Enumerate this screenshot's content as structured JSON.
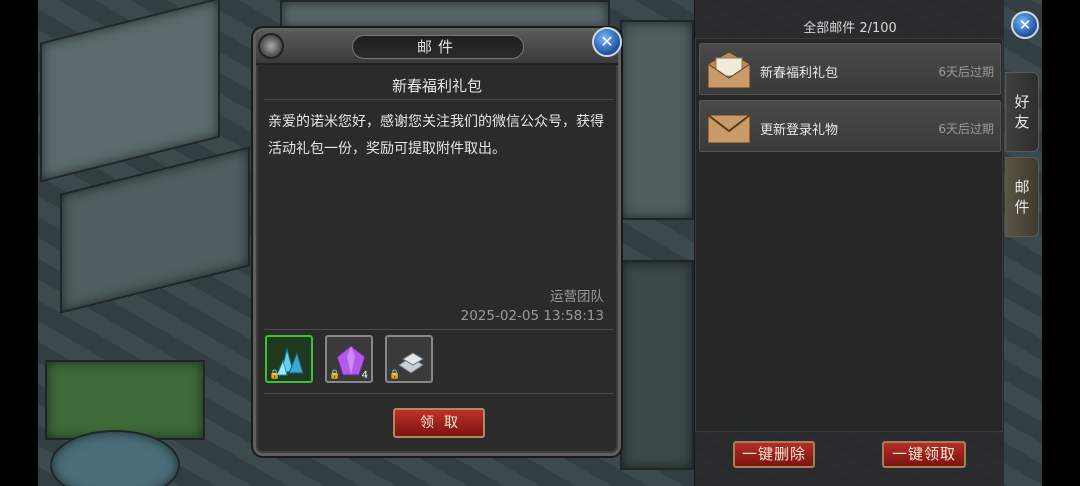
{
  "dialog": {
    "title": "邮件",
    "close_icon": "close-x-icon",
    "subject": "新春福利礼包",
    "body": "亲爱的诺米您好，感谢您关注我们的微信公众号，获得活动礼包一份，奖励可提取附件取出。",
    "sender": "运营团队",
    "date": "2025-02-05 13:58:13",
    "attachments": [
      {
        "icon": "blue-crystal-icon",
        "locked": true,
        "quantity": ""
      },
      {
        "icon": "purple-gem-icon",
        "locked": true,
        "quantity": "4"
      },
      {
        "icon": "silver-ingot-icon",
        "locked": true,
        "quantity": ""
      }
    ],
    "claim_label": "领取"
  },
  "panel": {
    "mail_count": "全部邮件 2/100",
    "mails": [
      {
        "title": "新春福利礼包",
        "expiry": "6天后过期",
        "icon": "open-envelope-icon"
      },
      {
        "title": "更新登录礼物",
        "expiry": "6天后过期",
        "icon": "closed-envelope-icon"
      }
    ],
    "delete_all_label": "一键删除",
    "claim_all_label": "一键领取"
  },
  "tabs": [
    {
      "label": "好友",
      "active": false
    },
    {
      "label": "邮件",
      "active": true
    }
  ],
  "colors": {
    "accent_red": "#b72d27",
    "accent_blue": "#1c4f9c",
    "rare_green": "#38c238"
  }
}
